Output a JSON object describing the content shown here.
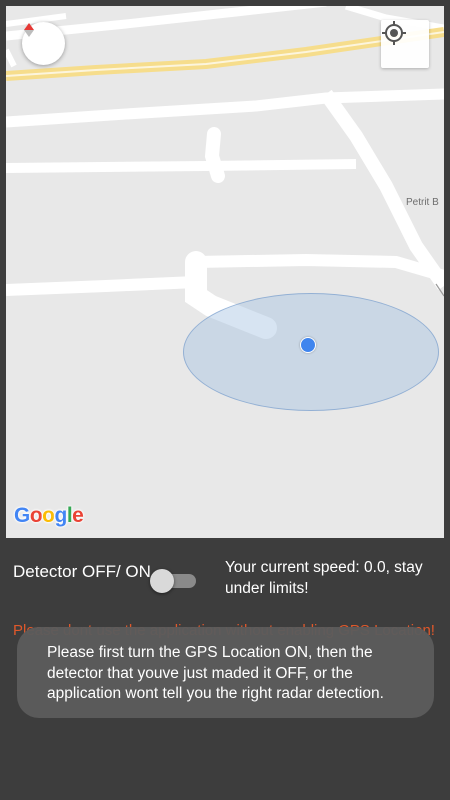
{
  "map": {
    "street_label": "Petrit B",
    "google_logo": {
      "letters": [
        "G",
        "o",
        "o",
        "g",
        "l",
        "e"
      ],
      "colors": [
        "#4285f4",
        "#ea4335",
        "#fbbc05",
        "#4285f4",
        "#34a853",
        "#ea4335"
      ]
    },
    "compass_icon": "compass-icon",
    "my_location_icon": "my-location-icon",
    "colors": {
      "land": "#e8e8e8",
      "road": "#ffffff",
      "highway": "#f6dd8c",
      "accuracy": "#a6c4e2",
      "dot": "#3f85ee"
    }
  },
  "controls": {
    "detector_label": "Detector OFF/ ON",
    "detector_on": false,
    "speed_text": "Your current speed: 0.0, stay under limits!"
  },
  "warning": {
    "text": "Please dont use the application without enabling GPS Location!"
  },
  "toast": {
    "text": "Please first turn the GPS Location ON, then the detector that youve just maded it OFF, or the application wont tell you the right radar detection."
  },
  "theme": {
    "background": "#3d3d3d",
    "warning_color": "#e0582b"
  }
}
